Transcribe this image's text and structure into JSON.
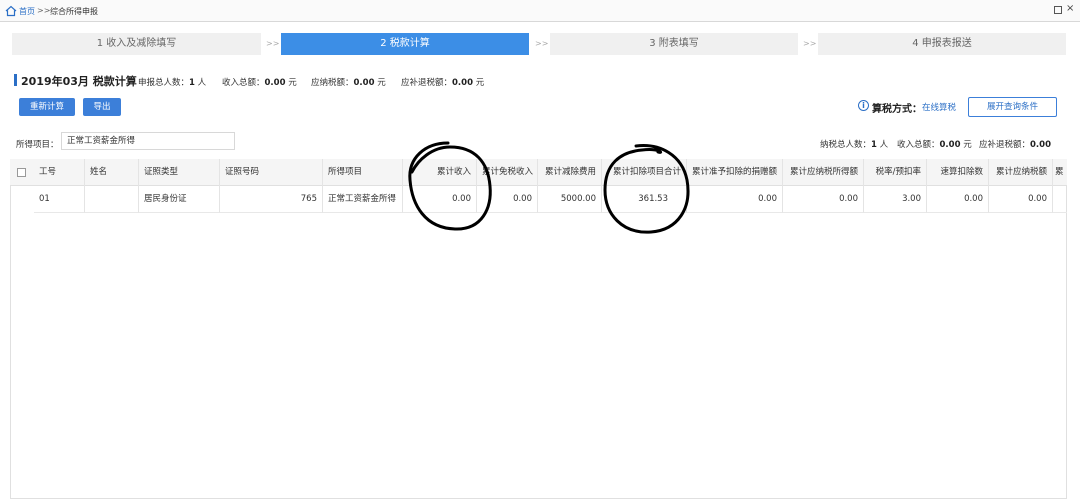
{
  "breadcrumb": {
    "home": "首页",
    "separator": ">>",
    "current": "综合所得申报"
  },
  "steps": [
    {
      "label": "1 收入及减除填写",
      "active": false
    },
    {
      "label": "2 税款计算",
      "active": true
    },
    {
      "label": "3 附表填写",
      "active": false
    },
    {
      "label": "4 申报表报送",
      "active": false
    }
  ],
  "step_arrow": ">>",
  "summary": {
    "title": "2019年03月 税款计算",
    "declarers_label": "申报总人数：",
    "declarers_value": "1",
    "declarers_unit": "人",
    "income_label": "收入总额：",
    "income_value": "0.00",
    "income_unit": "元",
    "tax_payable_label": "应纳税额：",
    "tax_payable_value": "0.00",
    "tax_payable_unit": "元",
    "refund_label": "应补退税额：",
    "refund_value": "0.00",
    "refund_unit": "元"
  },
  "toolbar": {
    "recalc_label": "重新计算",
    "export_label": "导出",
    "expand_query_label": "展开查询条件"
  },
  "calc_mode": {
    "label": "算税方式：",
    "value": "在线算税"
  },
  "filter": {
    "label": "所得项目：",
    "value": "正常工资薪金所得"
  },
  "right_summary": {
    "taxpayers_label": "纳税总人数：",
    "taxpayers_value": "1",
    "taxpayers_unit": "人",
    "income_label": "收入总额：",
    "income_value": "0.00",
    "income_unit": "元",
    "refund_label": "应补退税额：",
    "refund_value": "0.00"
  },
  "table": {
    "headers": [
      "工号",
      "姓名",
      "证照类型",
      "证照号码",
      "所得项目",
      "累计收入",
      "累计免税收入",
      "累计减除费用",
      "累计扣除项目合计",
      "累计准予扣除的捐赠额",
      "累计应纳税所得额",
      "税率/预扣率",
      "速算扣除数",
      "累计应纳税额",
      "累"
    ],
    "rows": [
      [
        "01",
        "",
        "居民身份证",
        "765",
        "正常工资薪金所得",
        "0.00",
        "0.00",
        "5000.00",
        "361.53",
        "0.00",
        "0.00",
        "3.00",
        "0.00",
        "0.00",
        ""
      ]
    ]
  }
}
